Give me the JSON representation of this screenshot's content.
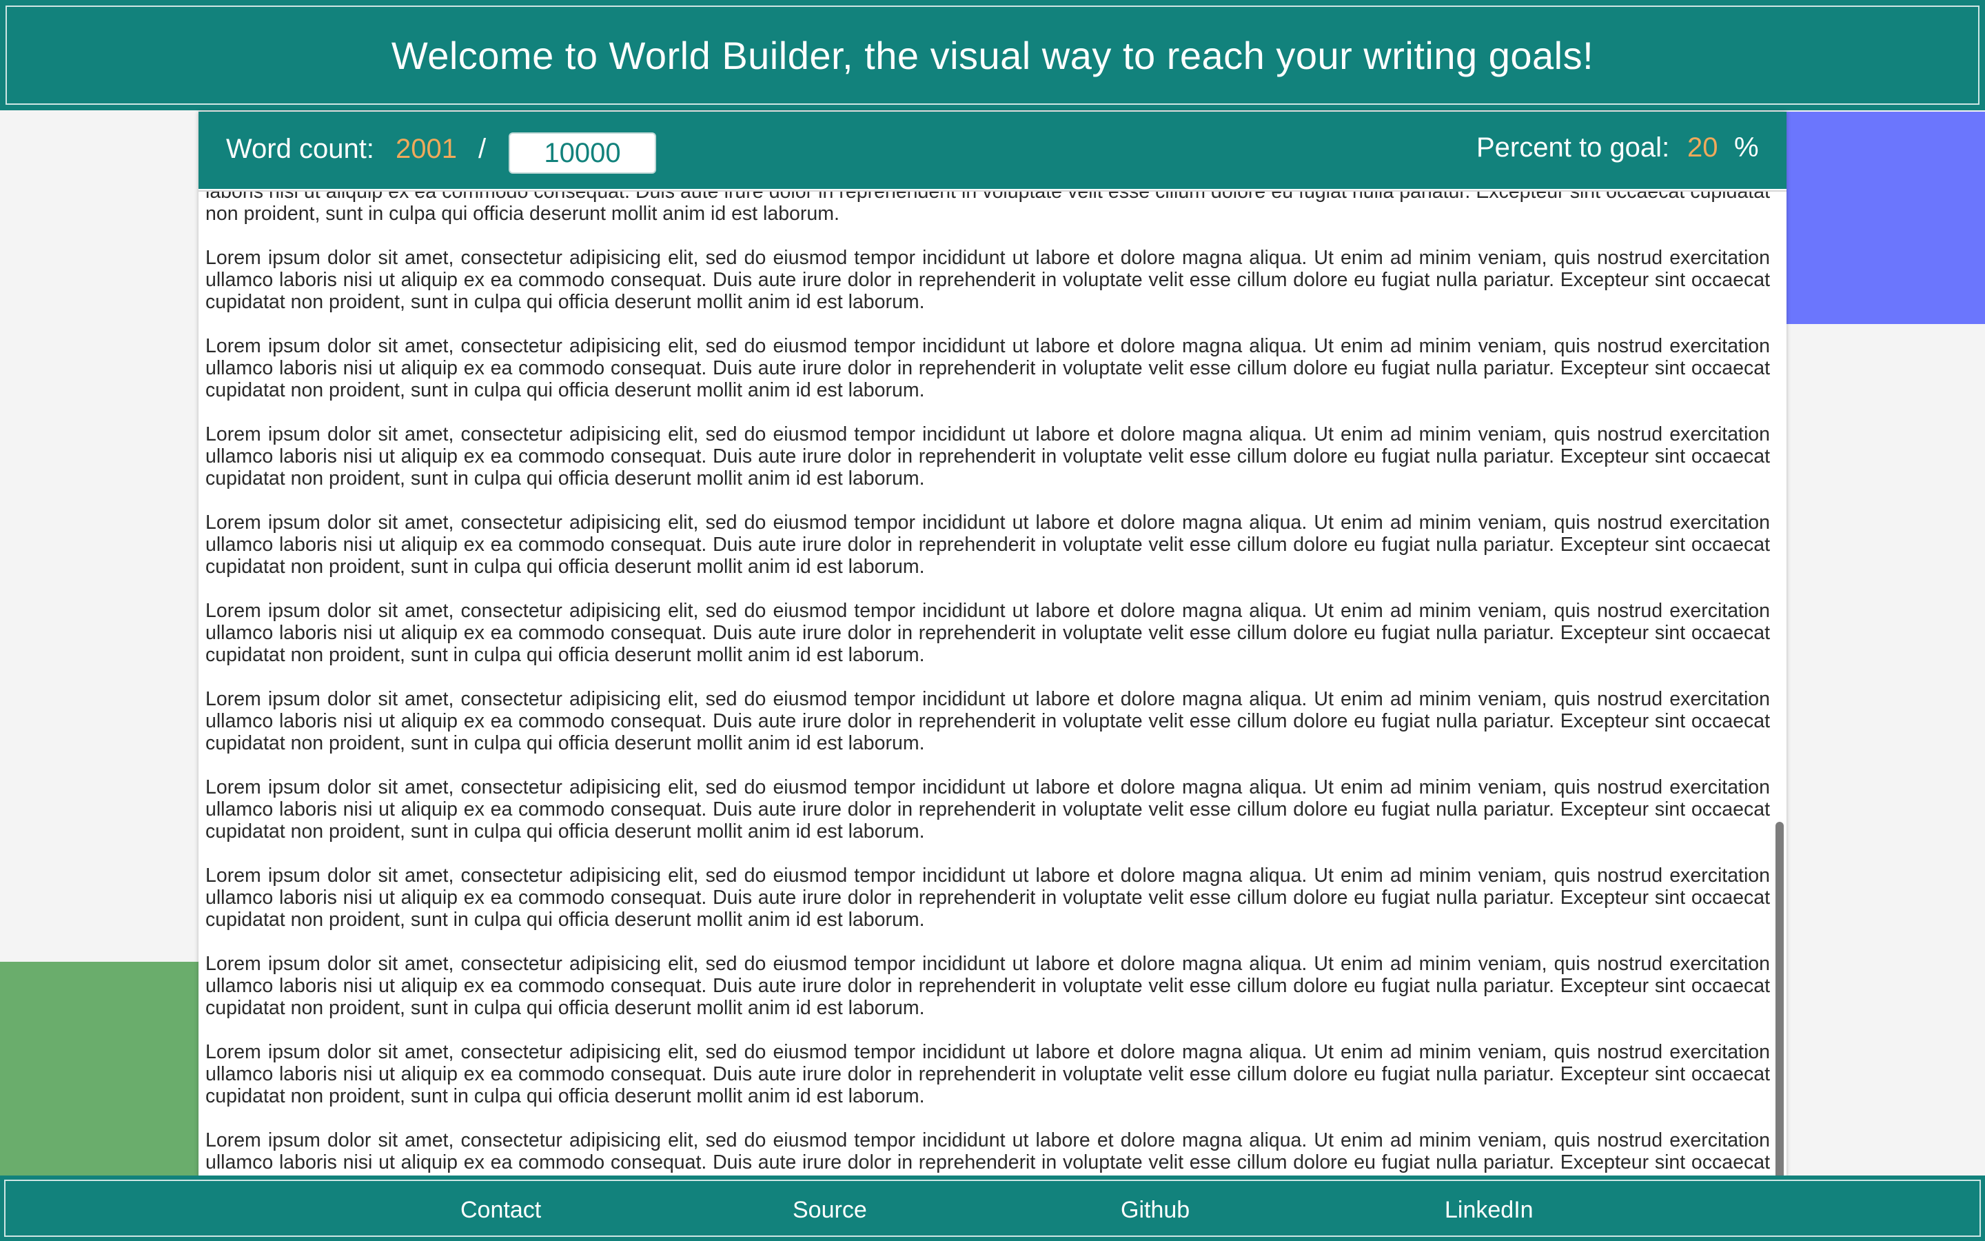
{
  "header": {
    "title": "Welcome to World Builder, the visual way to reach your writing goals!"
  },
  "stats": {
    "word_count_label": "Word count:",
    "word_count_value": "2001",
    "separator": "/",
    "goal_value": "10000",
    "percent_label": "Percent to goal:",
    "percent_value": "20",
    "percent_sign": "%"
  },
  "editor": {
    "first_partial_text": "laboris nisi ut aliquip ex ea commodo consequat. Duis aute irure dolor in reprehenderit in voluptate velit esse cillum dolore eu fugiat nulla pariatur. Excepteur sint occaecat cupidatat non proident, sunt in culpa qui officia deserunt mollit anim id est laborum.",
    "paragraph_text": "Lorem ipsum dolor sit amet, consectetur adipisicing elit, sed do eiusmod tempor incididunt ut labore et dolore magna aliqua. Ut enim ad minim veniam, quis nostrud exercitation ullamco laboris nisi ut aliquip ex ea commodo consequat. Duis aute irure dolor in reprehenderit in voluptate velit esse cillum dolore eu fugiat nulla pariatur. Excepteur sint occaecat cupidatat non proident, sunt in culpa qui officia deserunt mollit anim id est laborum.",
    "visible_full_paragraphs": 11
  },
  "footer": {
    "links": [
      "Contact",
      "Source",
      "Github",
      "LinkedIn"
    ]
  },
  "colors": {
    "primary": "#12827c",
    "accent_number": "#f0a95b",
    "deco_purple": "#6b76fd",
    "deco_green": "#6aad6c"
  }
}
